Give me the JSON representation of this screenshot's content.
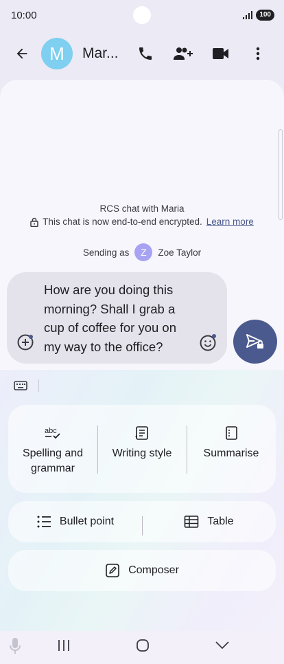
{
  "status_bar": {
    "time": "10:00",
    "battery": "100"
  },
  "header": {
    "avatar_letter": "M",
    "contact_name": "Mar..."
  },
  "chat_info": {
    "title": "RCS chat with Maria",
    "encryption_text": "This chat is now end-to-end encrypted.",
    "learn_more": "Learn more"
  },
  "sending_as": {
    "label": "Sending as",
    "avatar_letter": "Z",
    "name": "Zoe Taylor"
  },
  "composer": {
    "lines": [
      "How are you doing this",
      "morning? Shall I grab a",
      "cup of coffee for you on",
      "my way to the office?"
    ]
  },
  "assist": {
    "tools": [
      {
        "icon": "spellcheck-icon",
        "line1": "Spelling and",
        "line2": "grammar"
      },
      {
        "icon": "writing-style-icon",
        "line1": "Writing style",
        "line2": ""
      },
      {
        "icon": "summarise-icon",
        "line1": "Summarise",
        "line2": ""
      }
    ],
    "bullet_point": "Bullet point",
    "table": "Table",
    "composer": "Composer"
  },
  "colors": {
    "accent": "#4B5A8E",
    "avatar_contact": "#7ECFF0",
    "avatar_self": "#A7A3F2"
  }
}
